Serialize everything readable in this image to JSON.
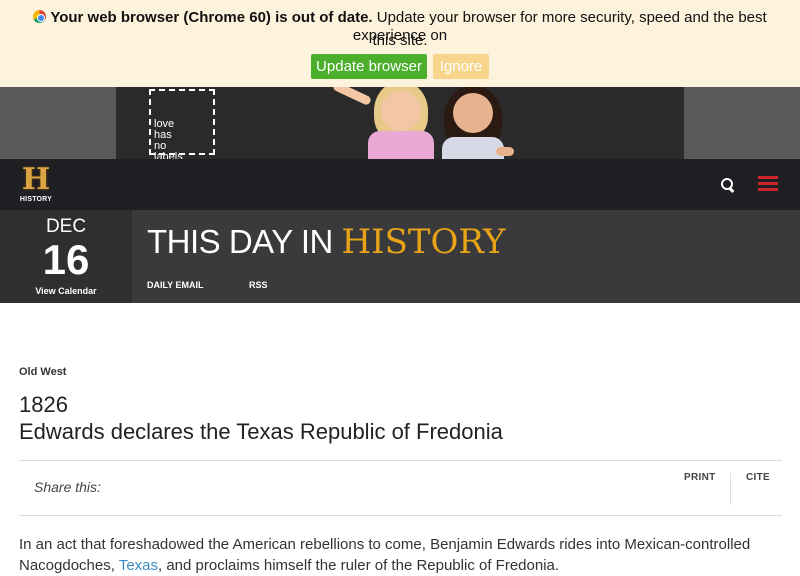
{
  "update_banner": {
    "bold_text": "Your web browser (Chrome 60) is out of date.",
    "message": "Update your browser for more security, speed and the best experience on",
    "message_cont": "this site.",
    "update_label": "Update browser",
    "ignore_label": "Ignore",
    "icon": "chrome-icon"
  },
  "ad": {
    "logo_lines": [
      "love",
      "has",
      "no",
      "labels"
    ]
  },
  "header": {
    "logo_text": "HISTORY",
    "logo_letter": "H",
    "icons": [
      "search-icon",
      "menu-icon"
    ]
  },
  "tdih": {
    "month": "DEC",
    "day": "16",
    "view_calendar": "View Calendar",
    "title_plain": "THIS DAY IN",
    "title_accent": "HISTORY",
    "links": [
      "DAILY EMAIL",
      "RSS"
    ]
  },
  "article": {
    "category": "Old West",
    "year": "1826",
    "headline": "Edwards declares the Texas Republic of Fredonia",
    "share_label": "Share this:",
    "print_label": "PRINT",
    "cite_label": "CITE",
    "body_part1": "In an act that foreshadowed the American rebellions to come, Benjamin Edwards rides into Mexican-controlled Nacogdoches,",
    "body_link": "Texas",
    "body_part2": ", and proclaims himself the ruler of the Republic of Fredonia."
  },
  "colors": {
    "banner_bg": "#fdf2dc",
    "update_btn": "#4caf2b",
    "ignore_btn": "#f7d58c",
    "nav_bg": "#1f1f24",
    "accent_gold": "#e8a317",
    "menu_red": "#d0232b",
    "link_blue": "#3b8cc4"
  }
}
